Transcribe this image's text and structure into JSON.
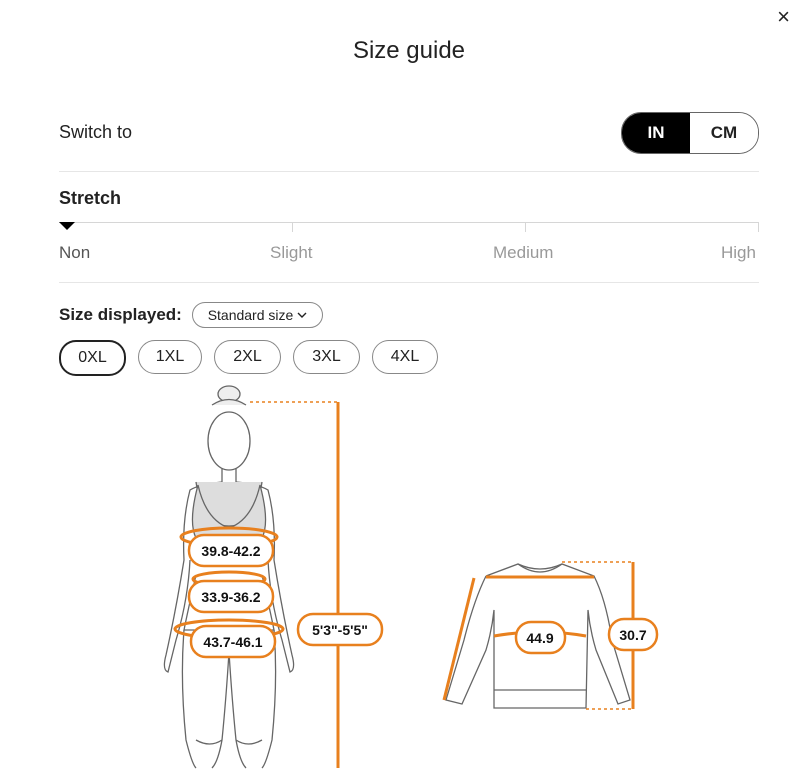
{
  "dialog": {
    "title": "Size guide",
    "close_label": "×"
  },
  "units": {
    "label": "Switch to",
    "options": [
      "IN",
      "CM"
    ],
    "selected": "IN"
  },
  "stretch": {
    "title": "Stretch",
    "levels": [
      "Non",
      "Slight",
      "Medium",
      "High"
    ],
    "selected": "Non"
  },
  "sizes": {
    "label": "Size displayed:",
    "dropdown_value": "Standard size",
    "options": [
      "0XL",
      "1XL",
      "2XL",
      "3XL",
      "4XL"
    ],
    "selected": "0XL"
  },
  "measurements": {
    "bust": "39.8-42.2",
    "waist": "33.9-36.2",
    "hips": "43.7-46.1",
    "height": "5'3\"-5'5\"",
    "garment_width": "44.9",
    "garment_length": "30.7"
  },
  "colors": {
    "accent": "#e8801e",
    "line": "#555555"
  }
}
